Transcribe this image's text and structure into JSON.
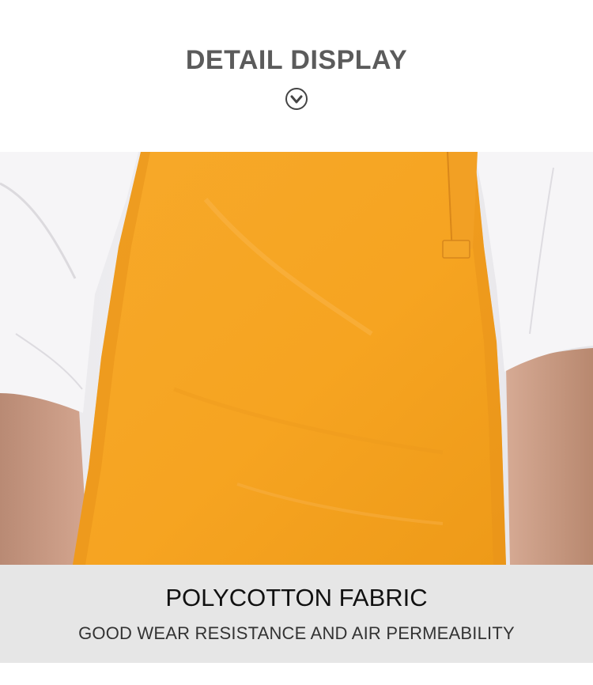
{
  "header": {
    "title": "DETAIL DISPLAY",
    "icon": "chevron-down-circle-icon"
  },
  "photo": {
    "subject": "product-photo",
    "apron_color": "#f5a623",
    "shirt_color": "#f4f3f5",
    "skin_color": "#c99a82"
  },
  "caption": {
    "title": "POLYCOTTON FABRIC",
    "subtitle": "GOOD WEAR RESISTANCE AND AIR PERMEABILITY"
  }
}
